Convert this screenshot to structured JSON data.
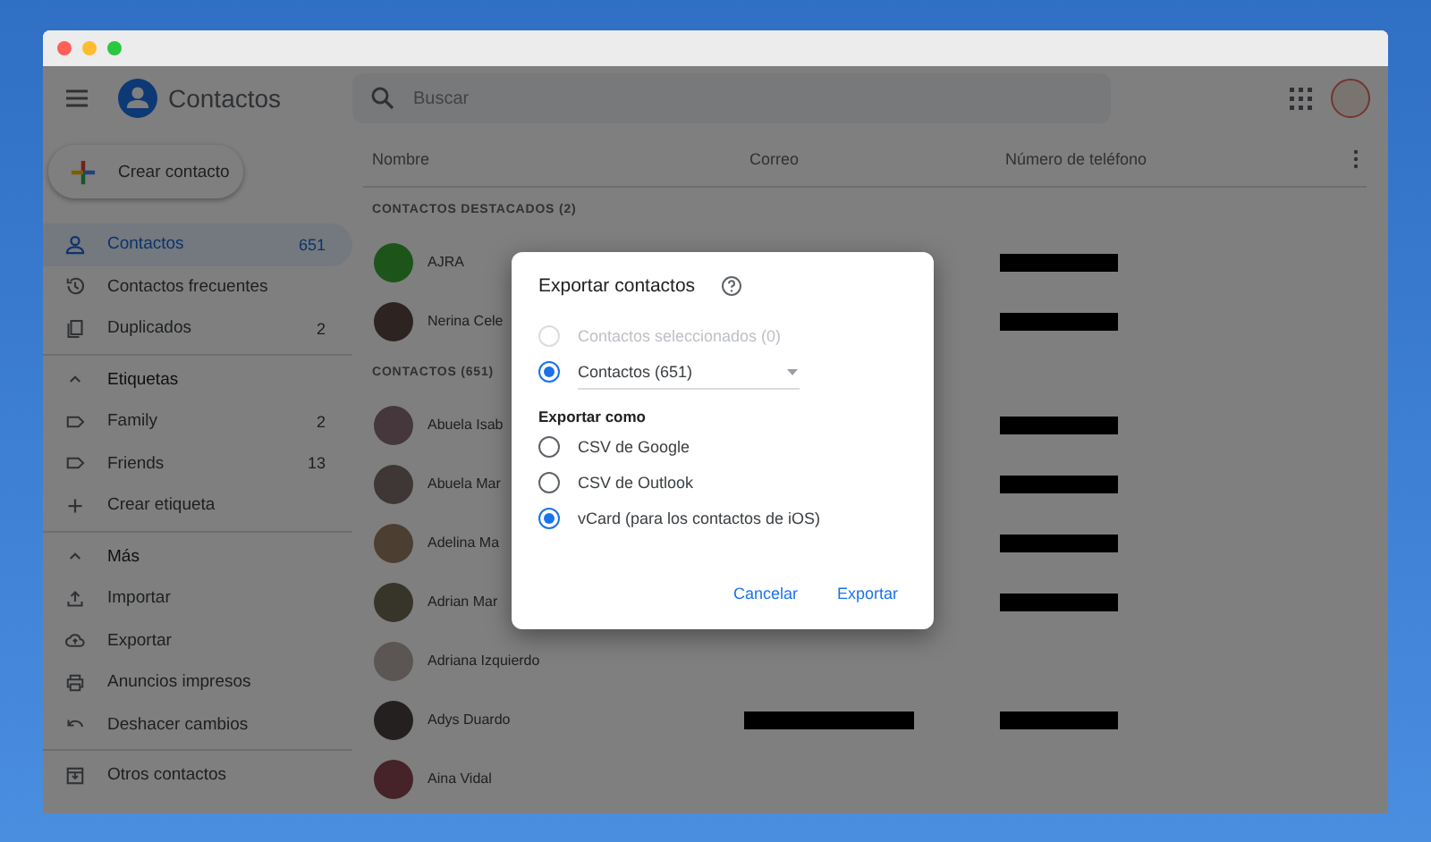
{
  "window": {
    "controls": [
      {
        "color": "#fe5f57"
      },
      {
        "color": "#febc2e"
      },
      {
        "color": "#28c840"
      }
    ]
  },
  "app": {
    "title": "Contactos"
  },
  "search": {
    "placeholder": "Buscar"
  },
  "sidebar": {
    "create_button": "Crear contacto",
    "groups": [
      {
        "items": [
          {
            "kind": "item",
            "label": "Contactos",
            "count": "651",
            "selected": true
          },
          {
            "kind": "item",
            "label": "Contactos frecuentes",
            "selected": false
          },
          {
            "kind": "item",
            "label": "Duplicados",
            "count": "2",
            "selected": false
          }
        ]
      },
      {
        "items": [
          {
            "kind": "header",
            "label": "Etiquetas",
            "selected": false
          },
          {
            "kind": "item",
            "label": "Family",
            "count": "2",
            "selected": false
          },
          {
            "kind": "item",
            "label": "Friends",
            "count": "13",
            "selected": false
          },
          {
            "kind": "item",
            "label": "Crear etiqueta",
            "selected": false
          }
        ]
      },
      {
        "items": [
          {
            "kind": "header",
            "label": "Más",
            "selected": false
          },
          {
            "kind": "item",
            "label": "Importar",
            "selected": false
          },
          {
            "kind": "item",
            "label": "Exportar",
            "selected": false
          },
          {
            "kind": "item",
            "label": "Anuncios impresos",
            "selected": false
          },
          {
            "kind": "item",
            "label": "Deshacer cambios",
            "selected": false
          }
        ]
      },
      {
        "items": [
          {
            "kind": "item",
            "label": "Otros contactos",
            "selected": false
          }
        ]
      }
    ]
  },
  "table": {
    "columns": [
      "Nombre",
      "Correo",
      "Número de teléfono"
    ],
    "sections": [
      {
        "title": "CONTACTOS DESTACADOS (2)",
        "rows": [
          {
            "name": "AJRA",
            "email_redacted": false,
            "phone_redacted": true
          },
          {
            "name": "Nerina Cele",
            "email_redacted": false,
            "phone_redacted": true
          }
        ]
      },
      {
        "title": "CONTACTOS (651)",
        "rows": [
          {
            "name": "Abuela Isab",
            "email_redacted": false,
            "phone_redacted": true
          },
          {
            "name": "Abuela Mar",
            "email_redacted": false,
            "phone_redacted": true
          },
          {
            "name": "Adelina Ma",
            "email_redacted": false,
            "phone_redacted": true
          },
          {
            "name": "Adrian Mar",
            "email_redacted": false,
            "phone_redacted": true
          },
          {
            "name": "Adriana Izquierdo",
            "email_redacted": false,
            "phone_redacted": false
          },
          {
            "name": "Adys Duardo",
            "email_redacted": true,
            "phone_redacted": true
          },
          {
            "name": "Aina Vidal",
            "email_redacted": false,
            "phone_redacted": false
          }
        ]
      }
    ]
  },
  "dialog": {
    "title": "Exportar contactos",
    "scope_options": [
      {
        "label": "Contactos seleccionados (0)",
        "selected": false,
        "disabled": true,
        "dropdown": false
      },
      {
        "label": "Contactos (651)",
        "selected": true,
        "disabled": false,
        "dropdown": true
      }
    ],
    "format_label": "Exportar como",
    "formats": [
      {
        "label": "CSV de Google",
        "selected": false
      },
      {
        "label": "CSV de Outlook",
        "selected": false
      },
      {
        "label": "vCard (para los contactos de iOS)",
        "selected": true
      }
    ],
    "buttons": [
      "Cancelar",
      "Exportar"
    ]
  }
}
